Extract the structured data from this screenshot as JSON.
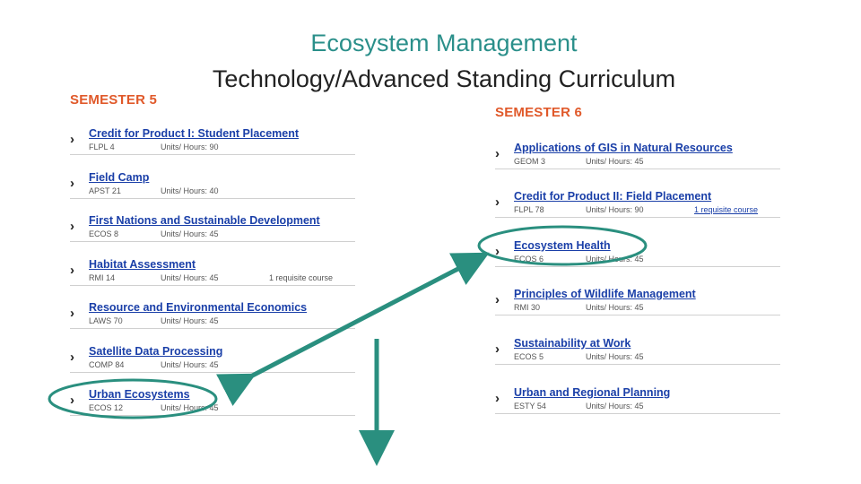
{
  "title": {
    "line1": "Ecosystem Management",
    "line2": "Technology/Advanced Standing Curriculum"
  },
  "semester5": {
    "heading": "SEMESTER 5",
    "courses": [
      {
        "name": "Credit for Product I: Student Placement",
        "code": "FLPL 4",
        "hours": "Units/ Hours: 90",
        "req": ""
      },
      {
        "name": "Field Camp",
        "code": "APST 21",
        "hours": "Units/ Hours: 40",
        "req": ""
      },
      {
        "name": "First Nations and Sustainable Development",
        "code": "ECOS 8",
        "hours": "Units/ Hours: 45",
        "req": ""
      },
      {
        "name": "Habitat Assessment",
        "code": "RMI 14",
        "hours": "Units/ Hours: 45",
        "req": "1 requisite course"
      },
      {
        "name": "Resource and Environmental Economics",
        "code": "LAWS 70",
        "hours": "Units/ Hours: 45",
        "req": ""
      },
      {
        "name": "Satellite Data Processing",
        "code": "COMP 84",
        "hours": "Units/ Hours: 45",
        "req": ""
      },
      {
        "name": "Urban Ecosystems",
        "code": "ECOS 12",
        "hours": "Units/ Hours: 45",
        "req": ""
      }
    ]
  },
  "semester6": {
    "heading": "SEMESTER 6",
    "courses": [
      {
        "name": "Applications of GIS in Natural Resources",
        "code": "GEOM 3",
        "hours": "Units/ Hours: 45",
        "req": ""
      },
      {
        "name": "Credit for Product II: Field Placement",
        "code": "FLPL 78",
        "hours": "Units/ Hours: 90",
        "req": "1 requisite course"
      },
      {
        "name": "Ecosystem Health",
        "code": "ECOS 6",
        "hours": "Units/ Hours: 45",
        "req": ""
      },
      {
        "name": "Principles of Wildlife Management",
        "code": "RMI 30",
        "hours": "Units/ Hours: 45",
        "req": ""
      },
      {
        "name": "Sustainability at Work",
        "code": "ECOS 5",
        "hours": "Units/ Hours: 45",
        "req": ""
      },
      {
        "name": "Urban and Regional Planning",
        "code": "ESTY 54",
        "hours": "Units/ Hours: 45",
        "req": ""
      }
    ]
  },
  "annotation_color": "#2a8f7f"
}
